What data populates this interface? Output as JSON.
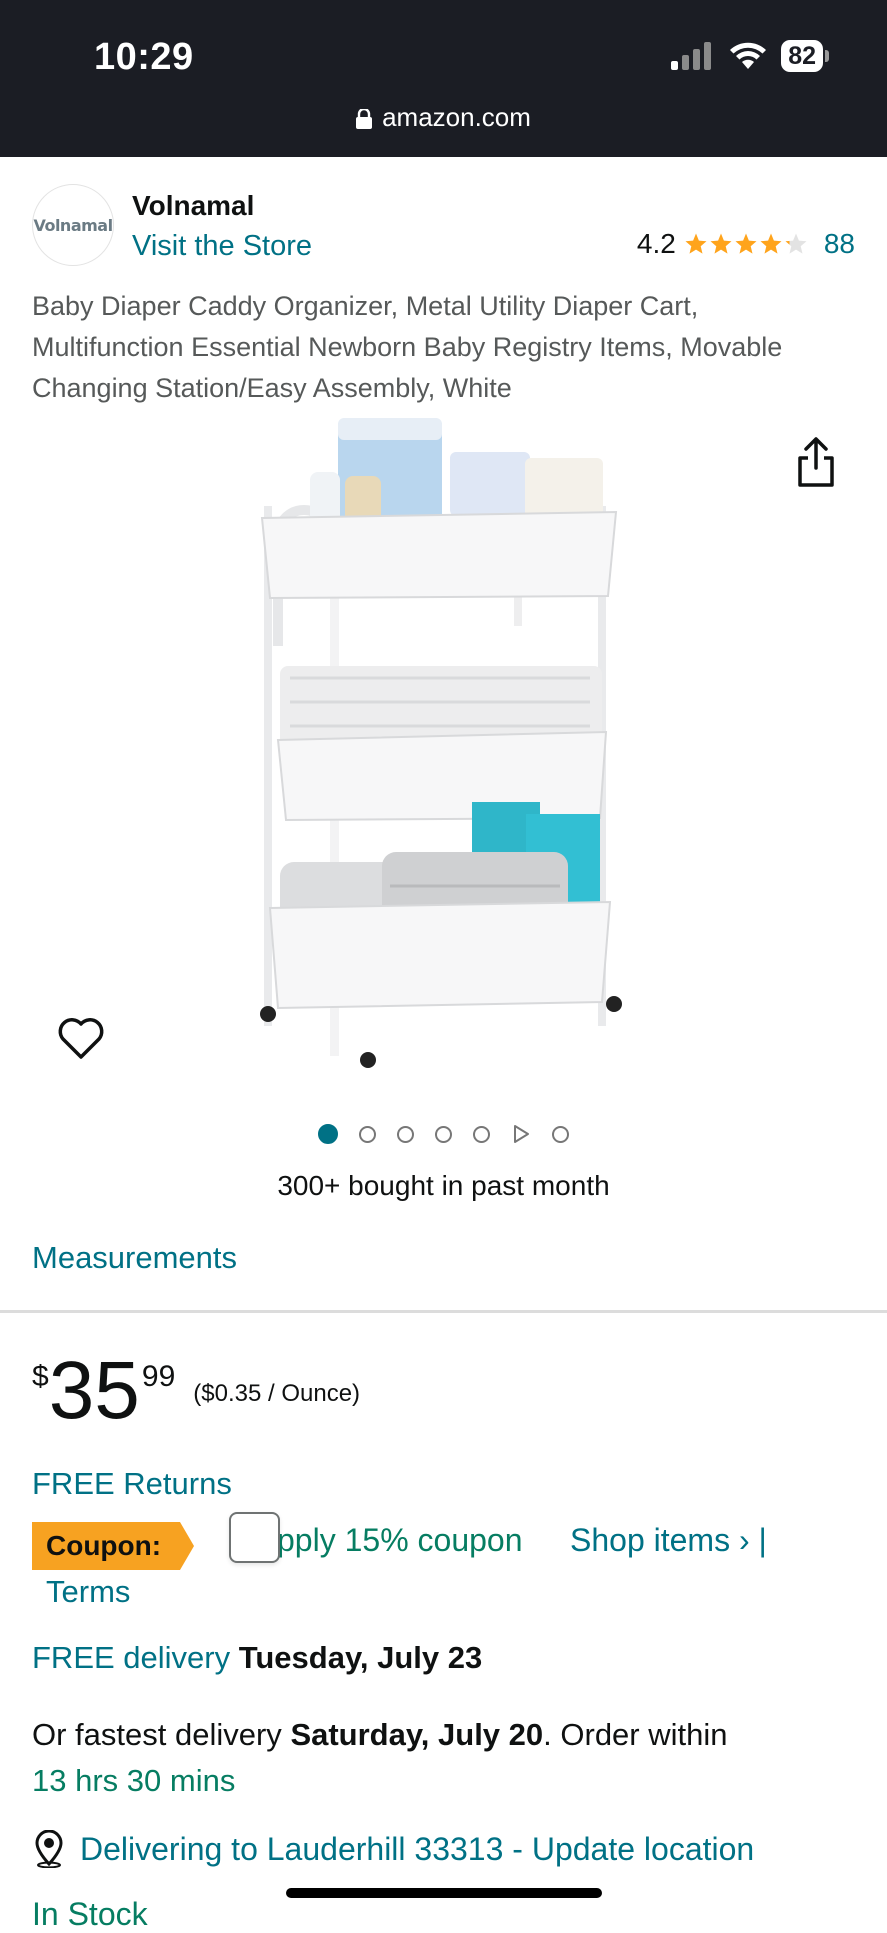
{
  "status_bar": {
    "time": "10:29",
    "battery": "82"
  },
  "browser": {
    "url": "amazon.com"
  },
  "brand": {
    "logo_text": "Volnamal",
    "name": "Volnamal",
    "visit_store": "Visit the Store"
  },
  "rating": {
    "value": "4.2",
    "stars": 4.2,
    "count": "88"
  },
  "product": {
    "title": "Baby Diaper Caddy Organizer, Metal Utility Diaper Cart, Multifunction Essential Newborn Baby Registry Items, Movable Changing Station/Easy Assembly, White",
    "image_icon": "product-photo-diaper-cart",
    "carousel": {
      "total": 7,
      "active": 1,
      "video_index": 6
    },
    "bought": "300+ bought in past month",
    "measurements": "Measurements"
  },
  "price": {
    "symbol": "$",
    "whole": "35",
    "fraction": "99",
    "unit_price": "($0.35 / Ounce)"
  },
  "returns": "FREE Returns",
  "coupon": {
    "badge": "Coupon:",
    "apply_text": "pply 15% coupon",
    "shop_items": "Shop items › |",
    "terms": "Terms"
  },
  "delivery": {
    "free_label": "FREE delivery",
    "free_date": "Tuesday, July 23",
    "fastest_prefix": "Or fastest delivery",
    "fastest_date": "Saturday, July 20",
    "order_within": ". Order within",
    "countdown": "13 hrs 30 mins"
  },
  "location": "Delivering to Lauderhill 33313 - Update location",
  "stock": "In Stock",
  "colors": {
    "link": "#007185",
    "green": "#067d62",
    "star": "#ffa41c",
    "coupon": "#f7a221"
  }
}
